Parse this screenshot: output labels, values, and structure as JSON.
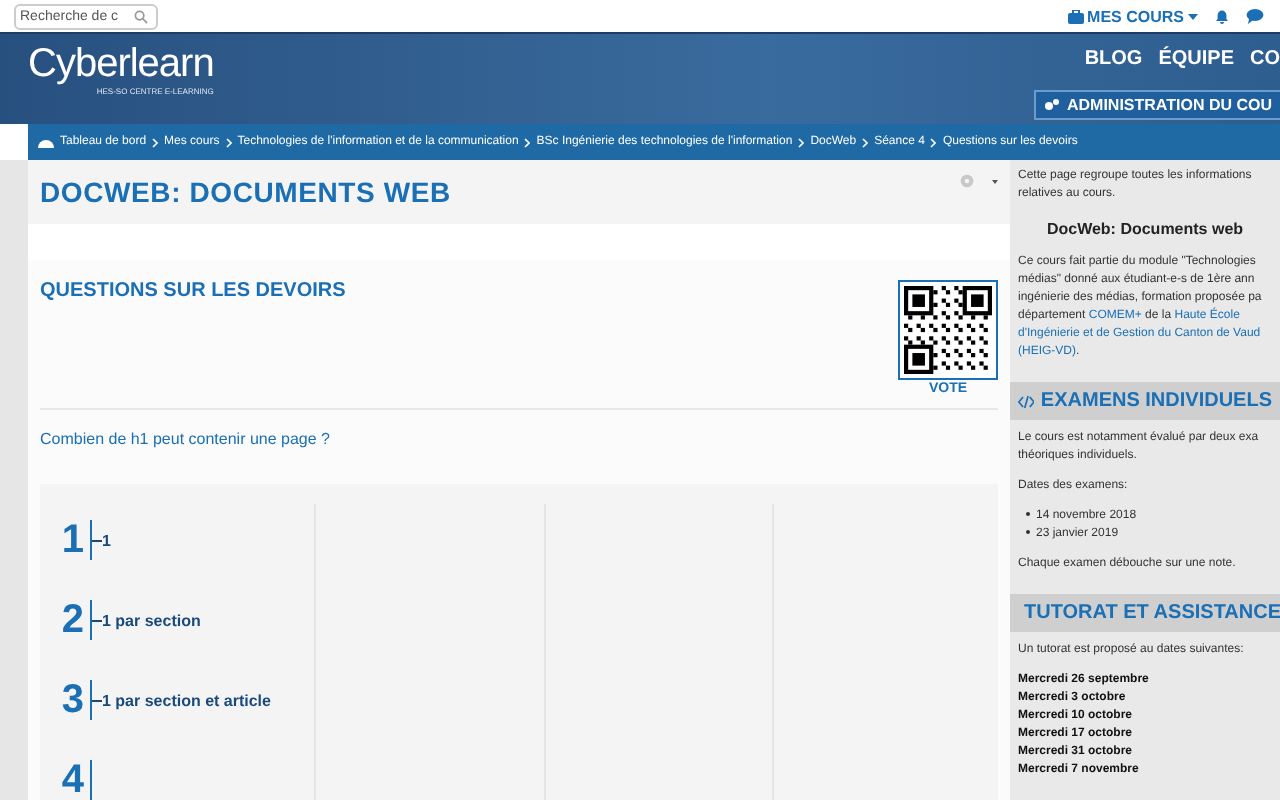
{
  "topbar": {
    "search": {
      "placeholder": "Recherche de c"
    },
    "my_courses": "MES COURS"
  },
  "banner": {
    "logo": "Cyberlearn",
    "logo_sub": "HES-SO CENTRE E-LEARNING",
    "nav": [
      "BLOG",
      "ÉQUIPE",
      "CO"
    ],
    "admin_button": "ADMINISTRATION DU COU"
  },
  "breadcrumb": [
    "Tableau de bord",
    "Mes cours",
    "Technologies de l'information et de la communication",
    "BSc Ingénierie des technologies de l'information",
    "DocWeb",
    "Séance 4",
    "Questions sur les devoirs"
  ],
  "course": {
    "title": "DOCWEB: DOCUMENTS WEB"
  },
  "activity": {
    "title": "QUESTIONS SUR LES DEVOIRS",
    "vote_label": "VOTE",
    "question": "Combien de h1 peut contenir une page ?",
    "answers": [
      {
        "number": "1",
        "text": "1"
      },
      {
        "number": "2",
        "text": "1 par section"
      },
      {
        "number": "3",
        "text": "1 par section et article"
      },
      {
        "number": "4"
      }
    ]
  },
  "sidebar": {
    "intro": "Cette page regroupe toutes les informations relatives au cours.",
    "course_name": "DocWeb: Documents web",
    "description": [
      [
        {
          "text": "Ce cours fait partie du module \"Technologies"
        }
      ],
      [
        {
          "text": "médias\" donné aux étudiant-e-s de 1ère ann"
        }
      ],
      [
        {
          "text": "ingénierie des médias, formation proposée pa"
        }
      ],
      [
        {
          "text": "département "
        },
        {
          "text": "COMEM+",
          "link": true
        },
        {
          "text": " de la "
        },
        {
          "text": "Haute École",
          "link": true
        }
      ],
      [
        {
          "text": "d'Ingénierie et de Gestion du Canton de Vaud",
          "link": true
        }
      ],
      [
        {
          "text": "(HEIG-VD)",
          "link": true
        },
        {
          "text": "."
        }
      ]
    ],
    "sections": [
      {
        "title": "EXAMENS INDIVIDUELS",
        "lines": [
          {
            "kind": "text",
            "text": "Le cours est notamment évalué par deux exa"
          },
          {
            "kind": "text",
            "text": "théoriques individuels."
          },
          {
            "kind": "gap"
          },
          {
            "kind": "text",
            "text": "Dates des examens:"
          },
          {
            "kind": "gap"
          },
          {
            "kind": "bullet",
            "text": "14 novembre 2018"
          },
          {
            "kind": "bullet",
            "text": "23 janvier 2019"
          },
          {
            "kind": "gap"
          },
          {
            "kind": "text",
            "text": "Chaque examen débouche sur une note."
          }
        ]
      },
      {
        "title": "TUTORAT ET ASSISTANCE",
        "lines": [
          {
            "kind": "text",
            "text": "Un tutorat est proposé au dates suivantes:"
          },
          {
            "kind": "gap"
          },
          {
            "kind": "bold",
            "text": "Mercredi 26 septembre"
          },
          {
            "kind": "bold",
            "text": "Mercredi 3 octobre"
          },
          {
            "kind": "bold",
            "text": "Mercredi 10 octobre"
          },
          {
            "kind": "bold",
            "text": "Mercredi 17 octobre"
          },
          {
            "kind": "bold",
            "text": "Mercredi 31 octobre"
          },
          {
            "kind": "bold",
            "text": "Mercredi 7 novembre"
          }
        ]
      }
    ]
  }
}
